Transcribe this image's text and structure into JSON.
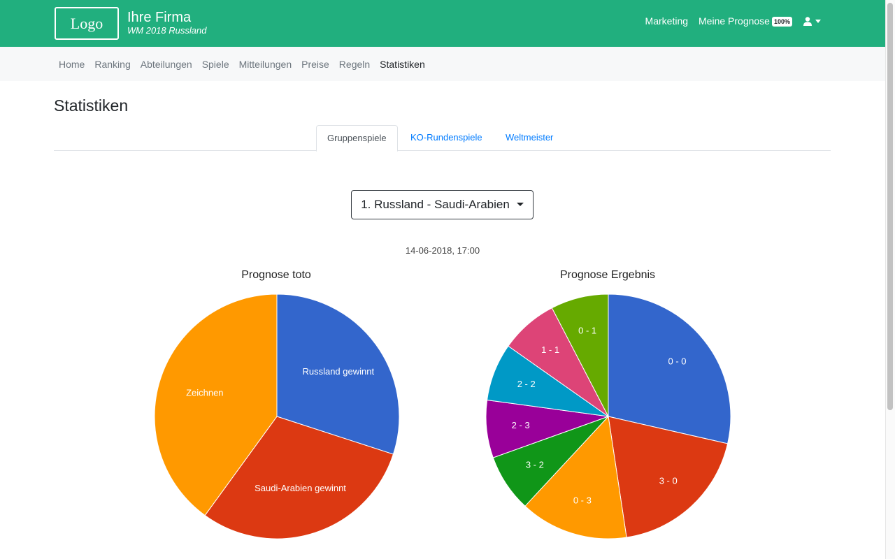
{
  "header": {
    "logo_text": "Logo",
    "company_name": "Ihre Firma",
    "company_subtitle": "WM 2018 Russland",
    "nav": {
      "marketing": "Marketing",
      "my_prediction": "Meine Prognose",
      "badge": "100%"
    },
    "user_icon": "user-icon"
  },
  "subnav": [
    "Home",
    "Ranking",
    "Abteilungen",
    "Spiele",
    "Mitteilungen",
    "Preise",
    "Regeln",
    "Statistiken"
  ],
  "main": {
    "title": "Statistiken",
    "tabs": [
      "Gruppenspiele",
      "KO-Rundenspiele",
      "Weltmeister"
    ],
    "match_select": "1. Russland - Saudi-Arabien",
    "match_date": "14-06-2018, 17:00"
  },
  "colors": {
    "header_bg": "#21af7e",
    "link": "#007bff"
  },
  "chart_data": [
    {
      "type": "pie",
      "title": "Prognose toto",
      "labels": [
        "Russland gewinnt",
        "Saudi-Arabien gewinnt",
        "Zeichnen"
      ],
      "values": [
        3,
        3,
        4
      ],
      "colors": [
        "#3366cc",
        "#dc3912",
        "#ff9900"
      ]
    },
    {
      "type": "pie",
      "title": "Prognose Ergebnis",
      "labels": [
        "0 - 0",
        "3 - 0",
        "0 - 3",
        "3 - 2",
        "2 - 3",
        "2 - 2",
        "1 - 1",
        "0 - 1"
      ],
      "values": [
        3,
        2,
        1.5,
        0.8,
        0.8,
        0.8,
        0.8,
        0.8
      ],
      "colors": [
        "#3366cc",
        "#dc3912",
        "#ff9900",
        "#109618",
        "#990099",
        "#0099c6",
        "#dd4477",
        "#66aa00"
      ]
    }
  ]
}
